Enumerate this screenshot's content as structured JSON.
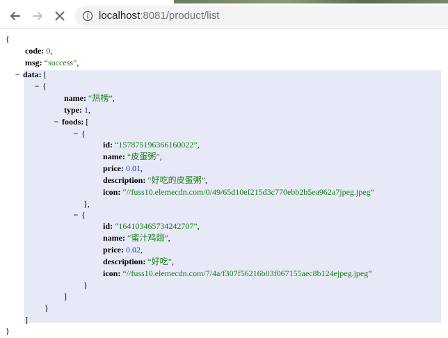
{
  "browser": {
    "url_host": "localhost",
    "url_rest": ":8081/product/list"
  },
  "json": {
    "open_brace": "{",
    "close_brace": "}",
    "code_key": "code:",
    "code_value": "0",
    "msg_key": "msg:",
    "msg_value": "“success”",
    "data_key": "data:",
    "collapse_toggle": "−",
    "item": {
      "name_key": "name:",
      "name_value": "“热榜”",
      "type_key": "type:",
      "type_value": "1",
      "foods_key": "foods:"
    },
    "foods": [
      {
        "id_key": "id:",
        "id_value": "“157875196366160022”",
        "name_key": "name:",
        "name_value": "“皮蛋粥”",
        "price_key": "price:",
        "price_value": "0.01",
        "description_key": "description:",
        "description_value": "“好吃的皮蛋粥”",
        "icon_key": "icon:",
        "icon_value": "“//fuss10.elemecdn.com/0/49/65d10ef215d3c770ebb2b5ea962a7jpeg.jpeg”"
      },
      {
        "id_key": "id:",
        "id_value": "“164103465734242707”",
        "name_key": "name:",
        "name_value": "“蜜汁鸡翅”",
        "price_key": "price:",
        "price_value": "0.02",
        "description_key": "description:",
        "description_value": "“好吃”",
        "icon_key": "icon:",
        "icon_value": "“//fuss10.elemecdn.com/7/4a/f307f56216b03f067155aec8b124ejpeg.jpeg”"
      }
    ]
  }
}
